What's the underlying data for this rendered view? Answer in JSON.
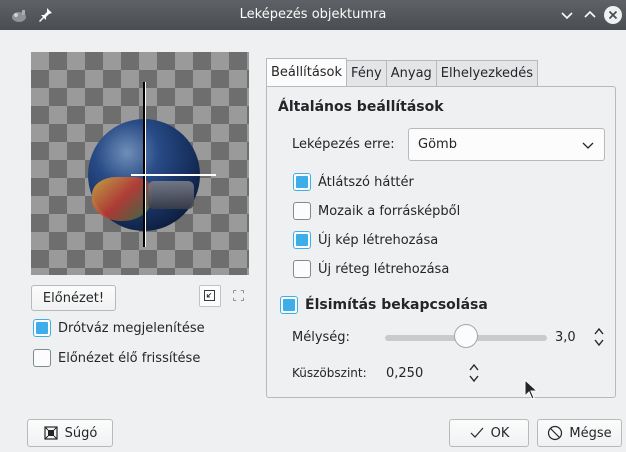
{
  "window": {
    "title": "Leképezés objektumra",
    "icons": [
      "gimp-icon",
      "pin-icon"
    ],
    "controls": [
      "minimize-icon",
      "maximize-icon",
      "close-icon"
    ]
  },
  "preview": {
    "button_label": "Előnézet!",
    "wireframe_label": "Drótváz megjelenítése",
    "wireframe_checked": true,
    "live_update_label": "Előnézet élő frissítése",
    "live_update_checked": false
  },
  "tabs": [
    {
      "label": "Beállítások",
      "active": true
    },
    {
      "label": "Fény",
      "active": false
    },
    {
      "label": "Anyag",
      "active": false
    },
    {
      "label": "Elhelyezkedés",
      "active": false
    }
  ],
  "settings": {
    "section_title": "Általános beállítások",
    "map_to_label": "Leképezés erre:",
    "map_to_value": "Gömb",
    "options": [
      {
        "label": "Átlátszó háttér",
        "checked": true
      },
      {
        "label": "Mozaik a forrásképből",
        "checked": false
      },
      {
        "label": "Új kép létrehozása",
        "checked": true
      },
      {
        "label": "Új réteg létrehozása",
        "checked": false
      }
    ],
    "antialias_label": "Élsimítás bekapcsolása",
    "antialias_checked": true,
    "depth_label": "Mélység:",
    "depth_value": "3,0",
    "depth_fraction": 0.5,
    "threshold_label": "Küszöbszint:",
    "threshold_value": "0,250"
  },
  "footer": {
    "help_label": "Súgó",
    "ok_label": "OK",
    "cancel_label": "Mégse"
  },
  "colors": {
    "accent": "#3daee9",
    "titlebar": "#4f5357",
    "background": "#eff0f1"
  }
}
